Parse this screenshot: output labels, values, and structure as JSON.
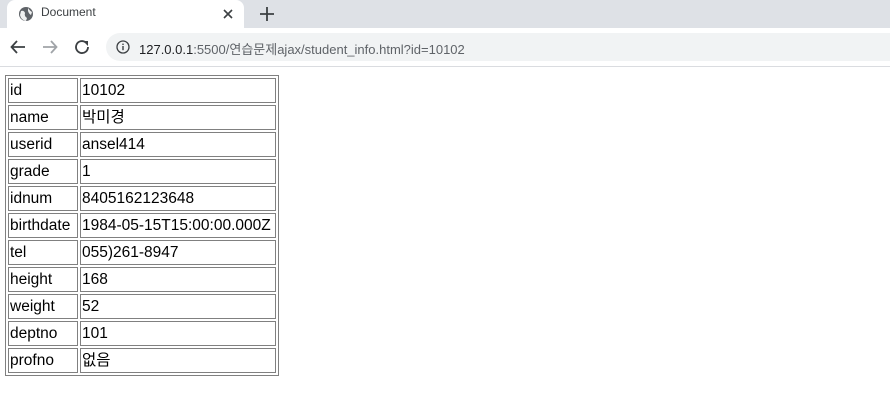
{
  "browser": {
    "tab_title": "Document",
    "url_host": "127.0.0.1",
    "url_path": ":5500/연습문제ajax/student_info.html?id=10102"
  },
  "student": {
    "rows": [
      {
        "key": "id",
        "value": "10102"
      },
      {
        "key": "name",
        "value": "박미경"
      },
      {
        "key": "userid",
        "value": "ansel414"
      },
      {
        "key": "grade",
        "value": "1"
      },
      {
        "key": "idnum",
        "value": "8405162123648"
      },
      {
        "key": "birthdate",
        "value": "1984-05-15T15:00:00.000Z"
      },
      {
        "key": "tel",
        "value": "055)261-8947"
      },
      {
        "key": "height",
        "value": "168"
      },
      {
        "key": "weight",
        "value": "52"
      },
      {
        "key": "deptno",
        "value": "101"
      },
      {
        "key": "profno",
        "value": "없음"
      }
    ]
  },
  "icons": {
    "favicon": "globe-icon",
    "tab_close": "close-icon",
    "new_tab": "plus-icon",
    "back": "arrow-left-icon",
    "forward": "arrow-right-icon",
    "reload": "reload-icon",
    "site_info": "info-icon"
  },
  "colors": {
    "tab_strip": "#dee1e6",
    "omnibox": "#f1f3f4",
    "table_border": "#808080"
  }
}
